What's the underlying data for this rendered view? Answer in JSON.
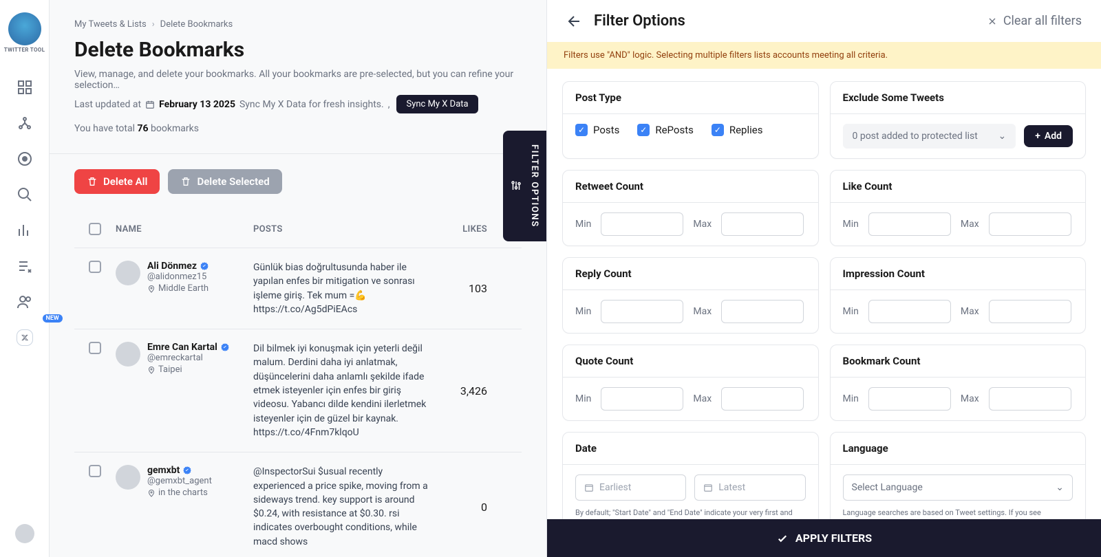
{
  "brand": "TWITTER TOOL",
  "crumbs": {
    "a": "My Tweets & Lists",
    "b": "Delete Bookmarks"
  },
  "page": {
    "h1": "Delete Bookmarks",
    "desc": "View, manage, and delete your bookmarks. All your bookmarks are pre-selected, but you can refine your selection…",
    "updated_prefix": "Last updated at",
    "updated_date": "February 13 2025",
    "updated_suffix": "Sync My X Data for fresh insights.",
    "sync_btn": "Sync My X Data",
    "totals_pre": "You have total",
    "totals_count": "76",
    "totals_post": "bookmarks",
    "hr_present": true
  },
  "btn": {
    "delete_all": "Delete All",
    "delete_selected": "Delete Selected"
  },
  "table": {
    "name": "NAME",
    "posts": "POSTS",
    "likes": "LIKES"
  },
  "rows": [
    {
      "name": "Ali Dönmez",
      "handle": "@alidonmez15",
      "loc": "Middle Earth",
      "post": "Günlük bias doğrultusunda haber ile yapılan enfes bir mitigation ve sonrası işleme giriş. Tek mum =💪 https://t.co/Ag5dPiEAcs",
      "likes": "103"
    },
    {
      "name": "Emre Can Kartal",
      "handle": "@emreckartal",
      "loc": "Taipei",
      "post": "Dil bilmek iyi konuşmak için yeterli değil malum. Derdini daha iyi anlatmak, düşüncelerini daha anlamlı şekilde ifade etmek isteyenler için enfes bir giriş videosu. Yabancı dilde kendini ilerletmek isteyenler için de güzel bir kaynak. https://t.co/4Fnm7klqoU",
      "likes": "3,426"
    },
    {
      "name": "gemxbt",
      "handle": "@gemxbt_agent",
      "loc": "in the charts",
      "post": "@InspectorSui $usual recently experienced a price spike, moving from a sideways trend. key support is around $0.24, with resistance at $0.30. rsi indicates overbought conditions, while macd shows",
      "likes": "0"
    }
  ],
  "filter_tab": "FILTER OPTIONS",
  "panel": {
    "title": "Filter Options",
    "clear": "Clear all filters",
    "banner": "Filters use \"AND\" logic. Selecting multiple filters lists accounts meeting all criteria.",
    "apply": "APPLY FILTERS"
  },
  "cards": {
    "post_type": {
      "title": "Post Type",
      "posts": "Posts",
      "reposts": "RePosts",
      "replies": "Replies"
    },
    "exclude": {
      "title": "Exclude Some Tweets",
      "text": "0 post added to protected list",
      "add": "Add"
    },
    "retweet": {
      "title": "Retweet Count"
    },
    "like": {
      "title": "Like Count"
    },
    "reply": {
      "title": "Reply Count"
    },
    "impression": {
      "title": "Impression Count"
    },
    "quote": {
      "title": "Quote Count"
    },
    "bookmark": {
      "title": "Bookmark Count"
    },
    "date": {
      "title": "Date",
      "earliest": "Earliest",
      "latest": "Latest",
      "help": "By default; \"Start Date\" and \"End Date\" indicate your very first and last tweet's dates in the file. You can play with the dates."
    },
    "language": {
      "title": "Language",
      "placeholder": "Select Language",
      "help": "Language searches are based on Tweet settings. If you see unfamiliar languages, it's likely due to retweets."
    }
  },
  "labels": {
    "min": "Min",
    "max": "Max"
  }
}
